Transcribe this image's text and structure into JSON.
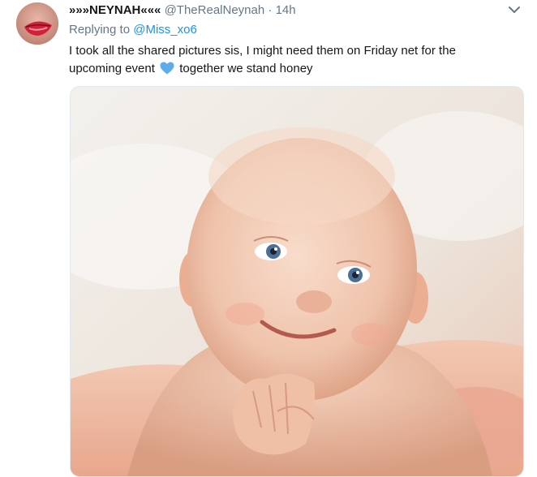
{
  "tweet": {
    "display_name": "»»»NEYNAH«««",
    "handle": "@TheRealNeynah",
    "separator": "·",
    "time": "14h",
    "reply_prefix": "Replying to",
    "reply_to": "@Miss_xo6",
    "text_part1": "I took all the shared pictures sis, I might need them on Friday net for the upcoming event",
    "text_part2": "together we stand honey",
    "emoji": "blue-heart-icon",
    "media": "photo"
  },
  "colors": {
    "link": "#1b95e0",
    "muted": "#657786",
    "text": "#14171a",
    "heart": "#5dadec"
  }
}
